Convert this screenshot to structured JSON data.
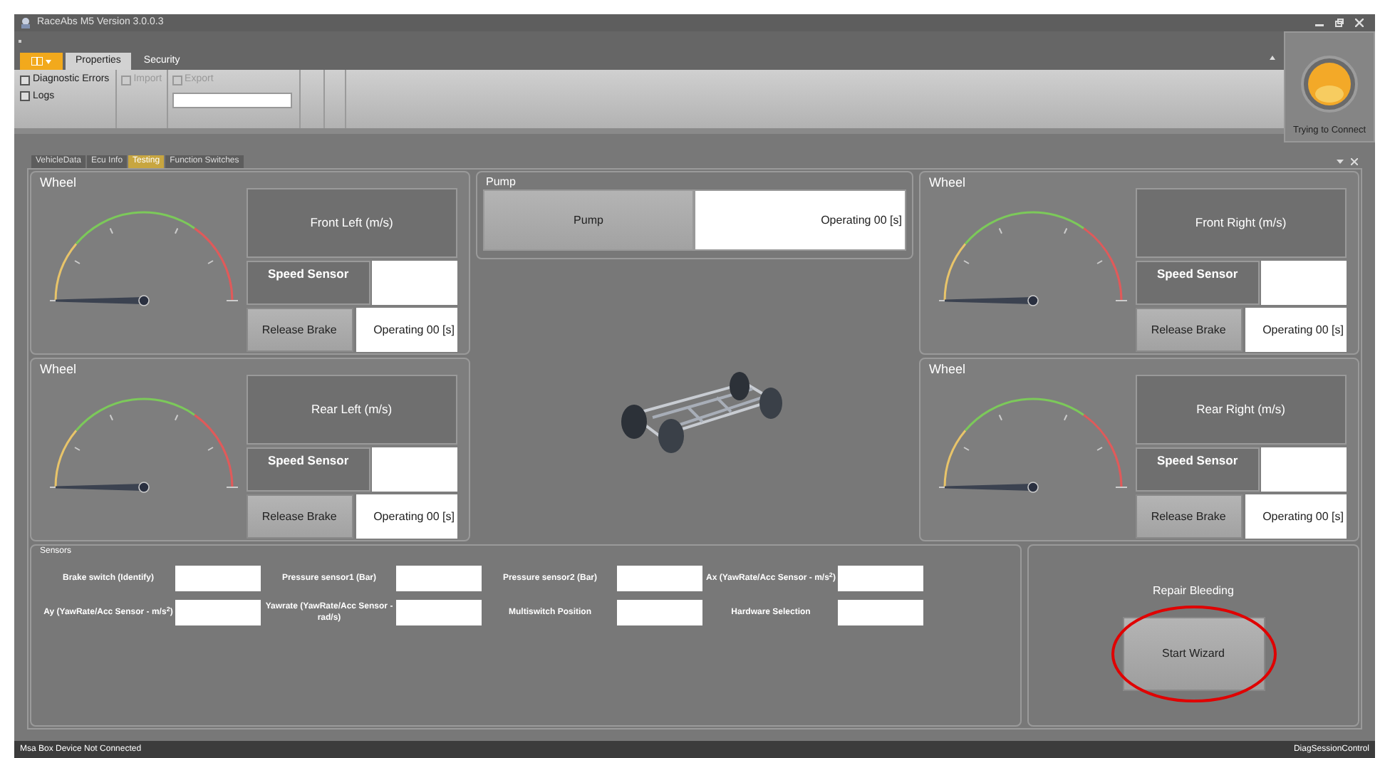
{
  "window": {
    "title": "RaceAbs M5 Version 3.0.0.3"
  },
  "ribbon": {
    "tabs": [
      {
        "label": "Properties",
        "selected": true
      },
      {
        "label": "Security",
        "selected": false
      }
    ],
    "items": [
      {
        "label": "Diagnostic Errors",
        "disabled": false
      },
      {
        "label": "Logs",
        "disabled": false
      },
      {
        "label": "Import",
        "disabled": true
      },
      {
        "label": "Export",
        "disabled": true
      }
    ]
  },
  "connection": {
    "status": "Trying to Connect"
  },
  "doc_tabs": [
    {
      "label": "VehicleData",
      "selected": false
    },
    {
      "label": "Ecu Info",
      "selected": false
    },
    {
      "label": "Testing",
      "selected": true
    },
    {
      "label": "Function Switches",
      "selected": false
    }
  ],
  "wheels": [
    {
      "title": "Wheel",
      "name": "Front Left (m/s)",
      "sensor_label": "Speed Sensor",
      "button": "Release Brake",
      "status": "Operating 00 [s]",
      "level": 0
    },
    {
      "title": "Wheel",
      "name": "Front Right (m/s)",
      "sensor_label": "Speed Sensor",
      "button": "Release Brake",
      "status": "Operating 00 [s]",
      "level": 0
    },
    {
      "title": "Wheel",
      "name": "Rear Left (m/s)",
      "sensor_label": "Speed Sensor",
      "button": "Release Brake",
      "status": "Operating 00 [s]",
      "level": 0
    },
    {
      "title": "Wheel",
      "name": "Rear Right (m/s)",
      "sensor_label": "Speed Sensor",
      "button": "Release Brake",
      "status": "Operating 00 [s]",
      "level": 0
    }
  ],
  "pump": {
    "title": "Pump",
    "button": "Pump",
    "status": "Operating 00 [s]"
  },
  "sensors": {
    "title": "Sensors",
    "fields": [
      "Brake switch (Identify)",
      "Pressure sensor1 (Bar)",
      "Pressure sensor2 (Bar)",
      "Ax (YawRate/Acc Sensor - m/s$^{2}$)",
      "Ay (YawRate/Acc Sensor - m/s$^{2}$)",
      "Yawrate (YawRate/Acc Sensor - rad/s)",
      "Multiswitch Position",
      "Hardware Selection"
    ]
  },
  "repair": {
    "title": "Repair Bleeding",
    "button": "Start Wizard"
  },
  "status_bar": {
    "left": "Msa Box Device Not Connected",
    "right": "DiagSessionControl"
  }
}
